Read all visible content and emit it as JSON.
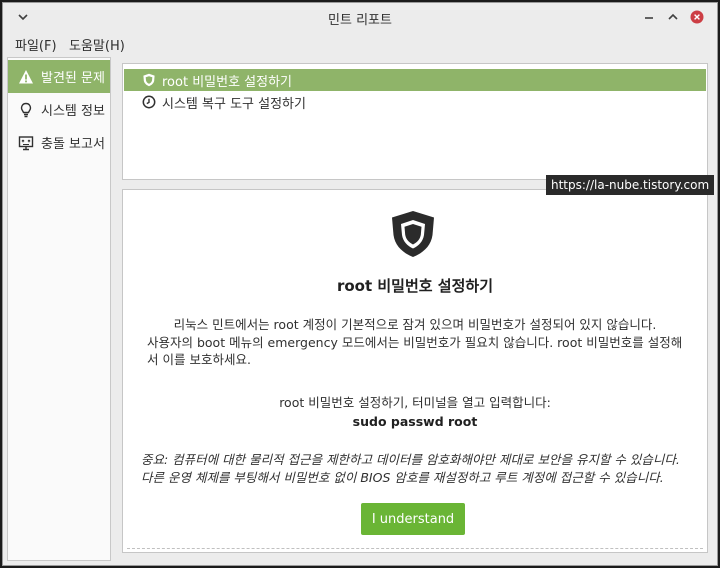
{
  "window": {
    "title": "민트 리포트",
    "menu": {
      "file": "파일(F)",
      "help": "도움말(H)"
    }
  },
  "sidebar": {
    "items": [
      {
        "label": "발견된 문제",
        "icon": "warning-icon",
        "active": true
      },
      {
        "label": "시스템 정보",
        "icon": "lightbulb-icon",
        "active": false
      },
      {
        "label": "충돌 보고서",
        "icon": "monitor-crash-icon",
        "active": false
      }
    ]
  },
  "issues": [
    {
      "label": "root 비밀번호 설정하기",
      "icon": "shield-icon",
      "selected": true
    },
    {
      "label": "시스템 복구 도구 설정하기",
      "icon": "clock-icon",
      "selected": false
    }
  ],
  "detail": {
    "icon": "shield-icon",
    "title": "root 비밀번호 설정하기",
    "paragraph1": "리눅스 민트에서는 root 계정이 기본적으로 잠겨 있으며 비밀번호가 설정되어 있지 않습니다.",
    "paragraph2": "사용자의 boot 메뉴의 emergency 모드에서는 비밀번호가 필요치 않습니다. root 비밀번호를 설정해서 이를 보호하세요.",
    "instruction": "root 비밀번호 설정하기, 터미널을 열고 입력합니다:",
    "command": "sudo passwd root",
    "note": "중요: 컴퓨터에 대한 물리적 접근을 제한하고 데이터를 암호화해야만 제대로 보안을 유지할 수 있습니다. 다른 운영 체제를 부팅해서 비밀번호 없이 BIOS 암호를 재설정하고 루트 계정에 접근할 수 있습니다.",
    "button": "I understand"
  },
  "watermark": "https://la-nube.tistory.com",
  "colors": {
    "accent": "#8fb469",
    "button": "#6ab535",
    "close_button": "#cc3e44"
  }
}
